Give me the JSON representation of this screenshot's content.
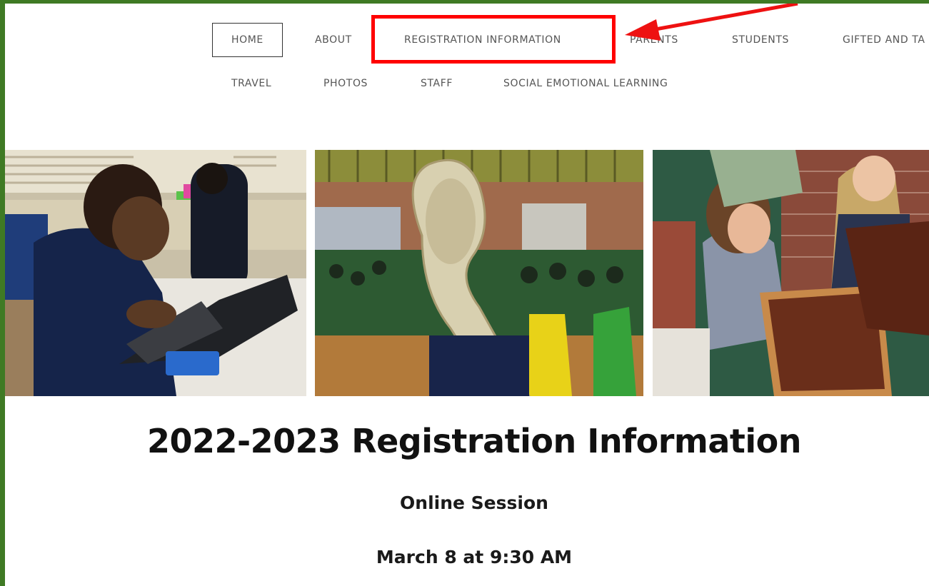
{
  "nav": {
    "row1": [
      "HOME",
      "ABOUT",
      "REGISTRATION INFORMATION",
      "PARENTS",
      "STUDENTS",
      "GIFTED AND TA"
    ],
    "row2": [
      "TRAVEL",
      "PHOTOS",
      "STAFF",
      "SOCIAL EMOTIONAL LEARNING"
    ],
    "active": "HOME"
  },
  "annotation": {
    "box_color": "#ff0000",
    "arrow_color": "#ee1111"
  },
  "photos": [
    {
      "name": "student-laptop-photo"
    },
    {
      "name": "sousaphone-gym-photo"
    },
    {
      "name": "sifting-dirt-photo"
    }
  ],
  "content": {
    "title": "2022-2023 Registration Information",
    "session": "Online Session",
    "date": "March 8 at 9:30 AM"
  },
  "colors": {
    "frame": "#3f7a24",
    "nav_text": "#555555",
    "heading": "#111111"
  }
}
